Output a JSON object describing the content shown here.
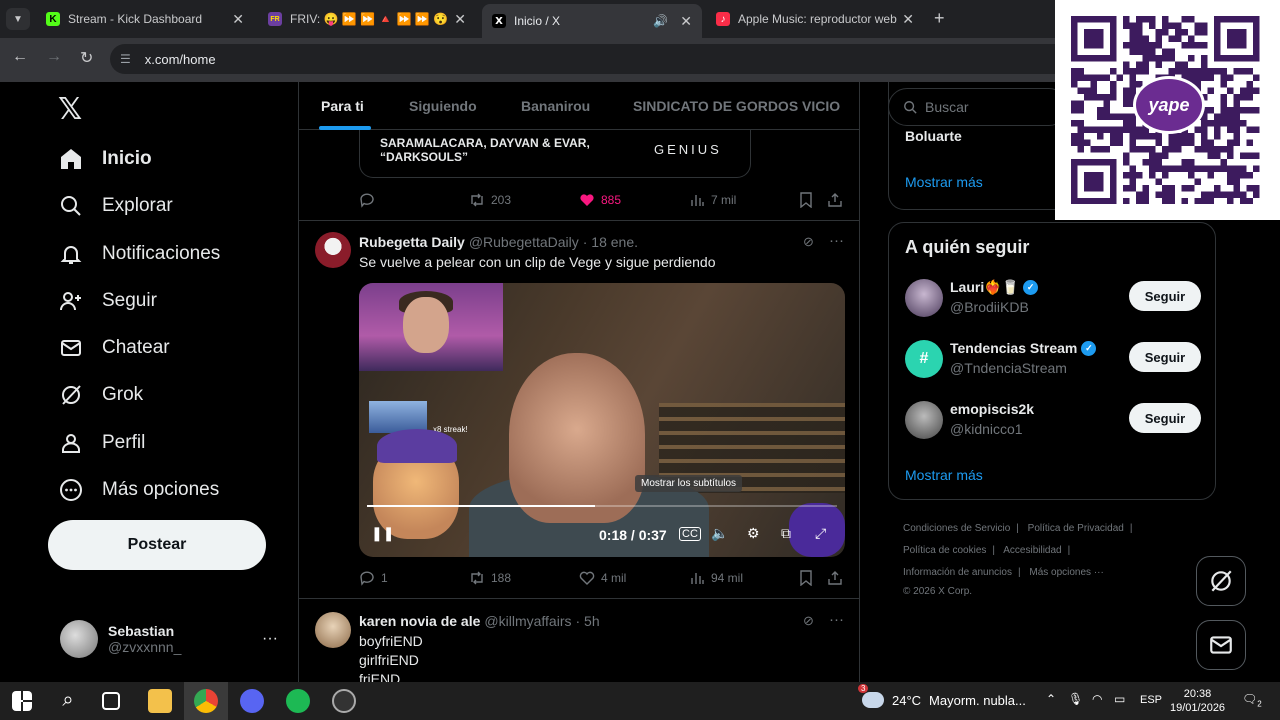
{
  "browser": {
    "tabs": [
      {
        "label": "Stream - Kick Dashboard",
        "favicon": "K",
        "favicon_color": "#53fc18"
      },
      {
        "label": "FRIV: 😛 ⏩ ⏩ 🔺 ⏩ ⏩ 😯",
        "favicon": "FR",
        "favicon_color": "#6b3fa0"
      },
      {
        "label": "Inicio / X",
        "favicon": "X",
        "favicon_color": "#000000",
        "active": true
      },
      {
        "label": "Apple Music: reproductor web",
        "favicon": "♪",
        "favicon_color": "#fa2d48"
      }
    ],
    "url": "x.com/home"
  },
  "sidebar": {
    "items": [
      {
        "label": "Inicio",
        "icon": "home-icon",
        "active": true
      },
      {
        "label": "Explorar",
        "icon": "search-icon"
      },
      {
        "label": "Notificaciones",
        "icon": "bell-icon"
      },
      {
        "label": "Seguir",
        "icon": "add-user-icon"
      },
      {
        "label": "Chatear",
        "icon": "mail-icon"
      },
      {
        "label": "Grok",
        "icon": "grok-icon"
      },
      {
        "label": "Perfil",
        "icon": "person-icon"
      },
      {
        "label": "Más opciones",
        "icon": "more-circle-icon"
      }
    ],
    "post_label": "Postear",
    "profile": {
      "name": "Sebastian",
      "handle": "@zvxxnnn_",
      "more": "···"
    }
  },
  "feed": {
    "tabs": [
      "Para ti",
      "Siguiendo",
      "Bananirou",
      "SINDICATO DE GORDOS VICIO"
    ],
    "prev_card": {
      "line1": "SARAMALACARA, DAYVAN & EVAR,",
      "line2": "“DARKSOULS”",
      "brand": "GENIUS"
    },
    "prev_actions": {
      "replies": "",
      "reposts": "203",
      "likes": "885",
      "views": "7 mil"
    },
    "post1": {
      "name": "Rubegetta Daily",
      "handle": "@RubegettaDaily",
      "time": "· 18 ene.",
      "text": "Se vuelve a pelear con un clip de Vege y sigue perdiendo",
      "video": {
        "time": "0:18 / 0:37",
        "tooltip": "Mostrar los subtítulos",
        "streak": "x8 streak!",
        "progress": 0.486
      },
      "actions": {
        "replies": "1",
        "reposts": "188",
        "likes": "4 mil",
        "views": "94 mil"
      }
    },
    "post2": {
      "name": "karen novia de ale",
      "handle": "@killmyaffairs",
      "time": "· 5h",
      "lines": [
        "boyfriEND",
        "girlfriEND",
        "friEND"
      ]
    }
  },
  "right": {
    "search_placeholder": "Buscar",
    "trend": "Boluarte",
    "show_more": "Mostrar más",
    "follow_title": "A quién seguir",
    "who": [
      {
        "name": "Lauri❤️‍🔥🥛",
        "handle": "@BrodiiKDB",
        "button": "Seguir",
        "verified": true,
        "color": "#5b4a6a"
      },
      {
        "name": "Tendencias Stream",
        "handle": "@TndenciaStream",
        "button": "Seguir",
        "verified": true,
        "color": "#2bd4b0"
      },
      {
        "name": "emopiscis2k",
        "handle": "@kidnicco1",
        "button": "Seguir",
        "verified": false,
        "color": "#6a6a6a"
      }
    ],
    "footer": [
      "Condiciones de Servicio",
      "Política de Privacidad",
      "Política de cookies",
      "Accesibilidad",
      "Información de anuncios",
      "Más opciones ···",
      "© 2026 X Corp."
    ]
  },
  "qr": {
    "badge": "yape"
  },
  "taskbar": {
    "weather": {
      "temp": "24°C",
      "desc": "Mayorm. nubla...",
      "alert": "3"
    },
    "lang": "ESP",
    "time": "20:38",
    "date": "19/01/2026",
    "notif_count": "2"
  },
  "colors": {
    "accent": "#1d9bf0",
    "like": "#f91880",
    "bg": "#000000"
  }
}
